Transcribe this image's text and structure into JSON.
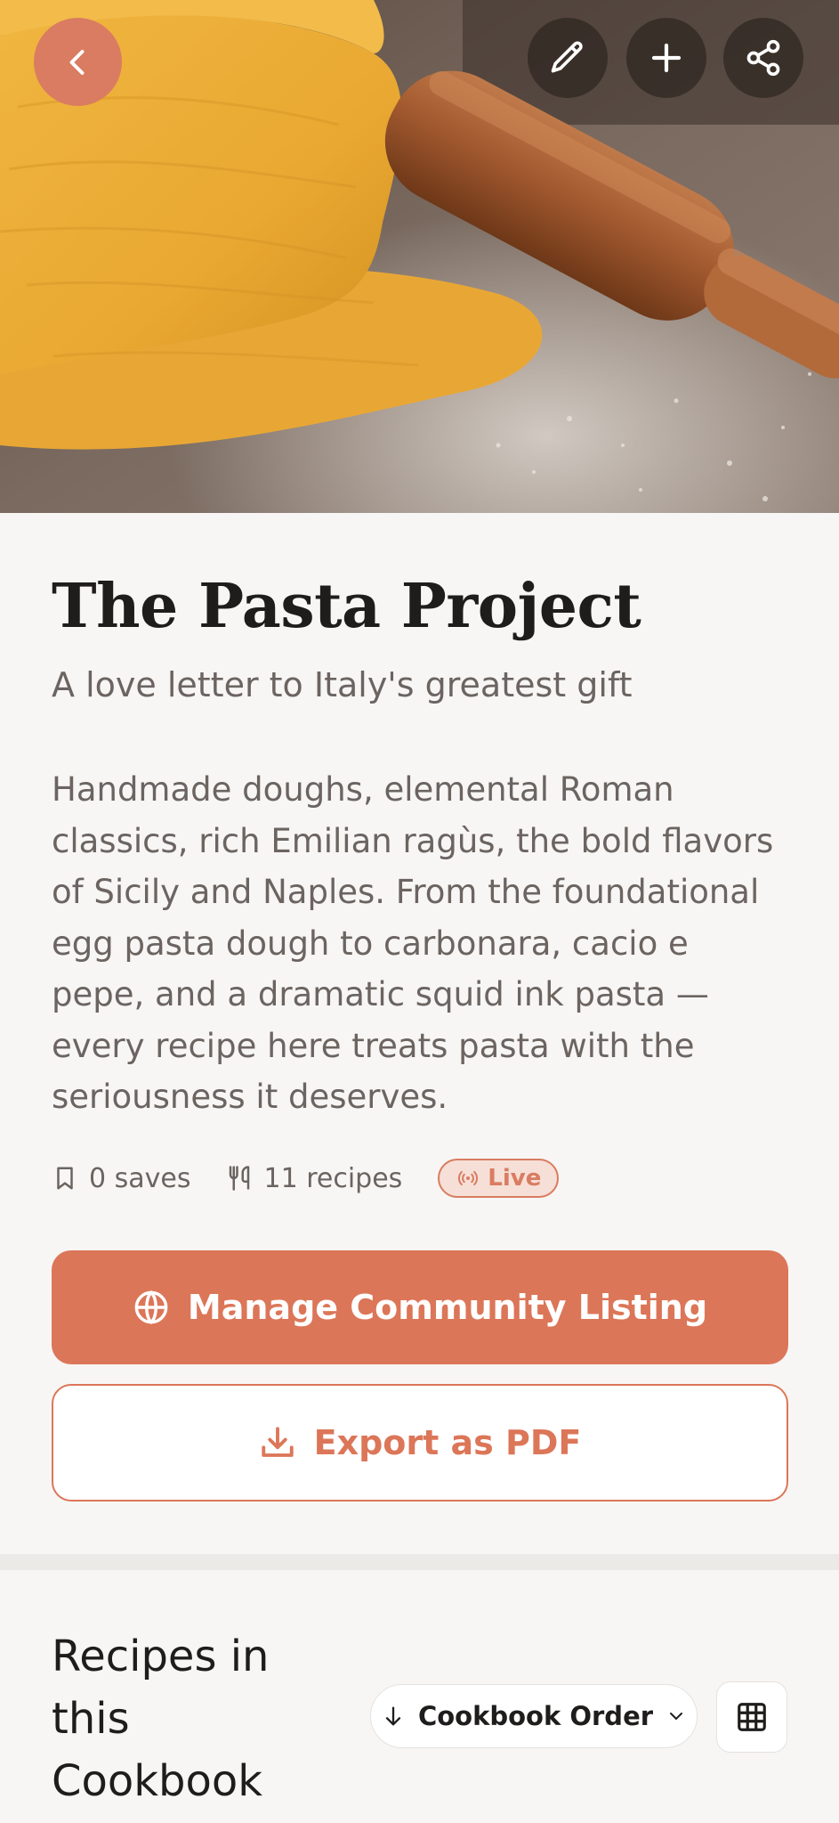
{
  "header": {
    "back_icon": "chevron-left-icon",
    "actions": [
      {
        "icon": "pencil-icon"
      },
      {
        "icon": "plus-icon"
      },
      {
        "icon": "share-icon"
      }
    ]
  },
  "cookbook": {
    "title": "The Pasta Project",
    "subtitle": "A love letter to Italy's greatest gift",
    "description": "Handmade doughs, elemental Roman classics, rich Emilian ragùs, the bold flavors of Sicily and Naples. From the foundational egg pasta dough to carbonara, cacio e pepe, and a dramatic squid ink pasta — every recipe here treats pasta with the seriousness it deserves."
  },
  "stats": {
    "saves": "0 saves",
    "recipes": "11 recipes",
    "status": "Live"
  },
  "actions": {
    "primary_label": "Manage Community Listing",
    "secondary_label": "Export as PDF"
  },
  "recipes_section": {
    "title": "Recipes in this Cookbook",
    "sort_label": "Cookbook Order"
  },
  "colors": {
    "accent": "#dc7658",
    "badge_bg": "#f6dfd6",
    "text": "#1f1d1c",
    "muted": "#6b6460",
    "background": "#f7f6f4"
  }
}
